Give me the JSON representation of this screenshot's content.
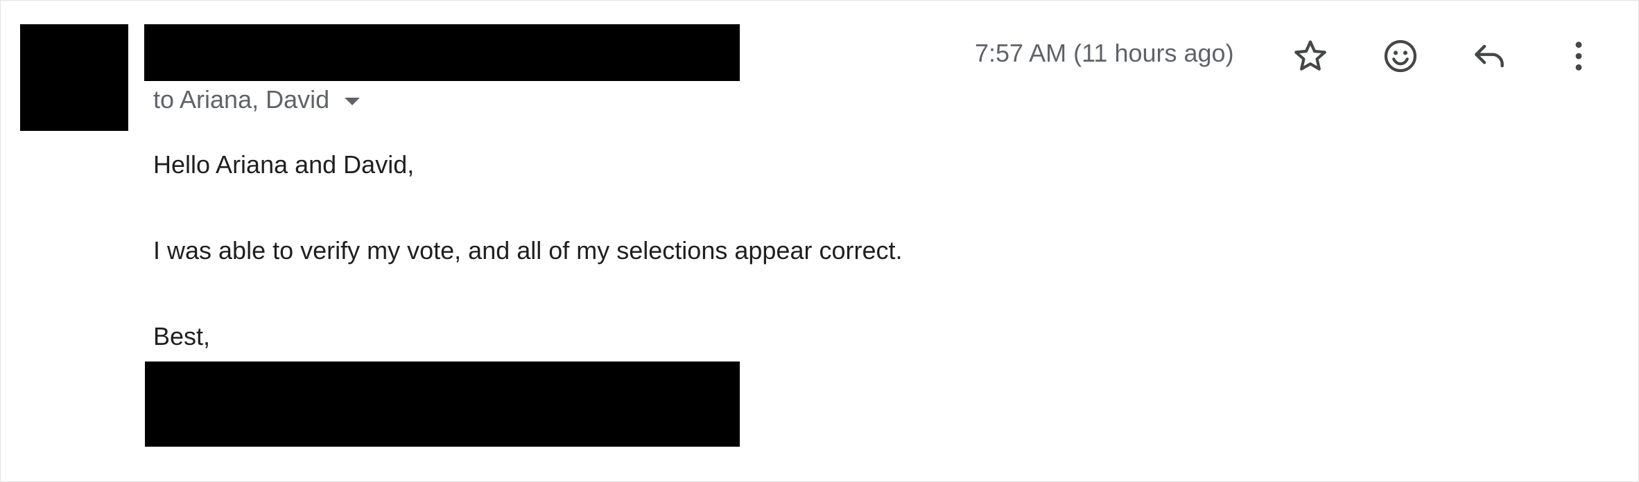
{
  "email": {
    "recipients_label": "to Ariana, David",
    "timestamp": "7:57 AM (11 hours ago)",
    "body": {
      "greeting": "Hello Ariana and David,",
      "message": "I was able to verify my vote, and all of my selections appear correct.",
      "signoff": "Best,"
    }
  },
  "toolbar": {
    "icons": [
      "star-icon",
      "emoji-icon",
      "reply-icon",
      "more-vert-icon"
    ]
  },
  "colors": {
    "meta_text": "#5f6368",
    "body_text": "#1f1f1f",
    "icon": "#444746",
    "redaction": "#000000"
  }
}
